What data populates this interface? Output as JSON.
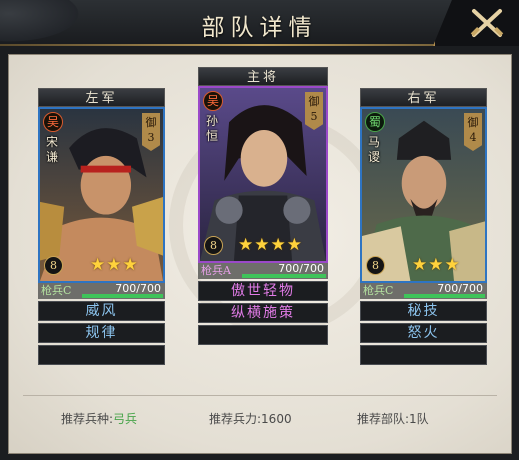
{
  "header": {
    "title": "部队详情"
  },
  "cards": [
    {
      "position": "左军",
      "faction": "吴",
      "name_v": "宋谦",
      "defense": "御",
      "defense_val": "3",
      "level": "8",
      "stars": "★★★",
      "troop_type": "枪兵C",
      "hp": "700/700",
      "hp_fraction": 1.0,
      "skills": [
        "威风",
        "规律",
        ""
      ],
      "frame": "blue"
    },
    {
      "position": "主将",
      "faction": "吴",
      "name_v": "孙恒",
      "defense": "御",
      "defense_val": "5",
      "level": "8",
      "stars": "★★★★",
      "troop_type": "枪兵A",
      "hp": "700/700",
      "hp_fraction": 1.0,
      "skills": [
        "傲世轻物",
        "纵横施策",
        ""
      ],
      "frame": "purple"
    },
    {
      "position": "右军",
      "faction": "蜀",
      "name_v": "马谡",
      "defense": "御",
      "defense_val": "4",
      "level": "8",
      "stars": "★★★",
      "troop_type": "枪兵C",
      "hp": "700/700",
      "hp_fraction": 1.0,
      "skills": [
        "秘技",
        "怒火",
        ""
      ],
      "frame": "blue"
    }
  ],
  "footer": {
    "rec_type_label": "推荐兵种:",
    "rec_type_value": "弓兵",
    "rec_power_label": "推荐兵力:",
    "rec_power_value": "1600",
    "rec_units_label": "推荐部队:",
    "rec_units_value": "1队"
  },
  "colors": {
    "blue_frame": "#2e74c2",
    "purple_frame": "#9b49c9",
    "skill_blue": "#8cc4ee",
    "skill_purple": "#e07be6",
    "hp_green": "#3fc45a",
    "rec_green": "#48a44a"
  }
}
